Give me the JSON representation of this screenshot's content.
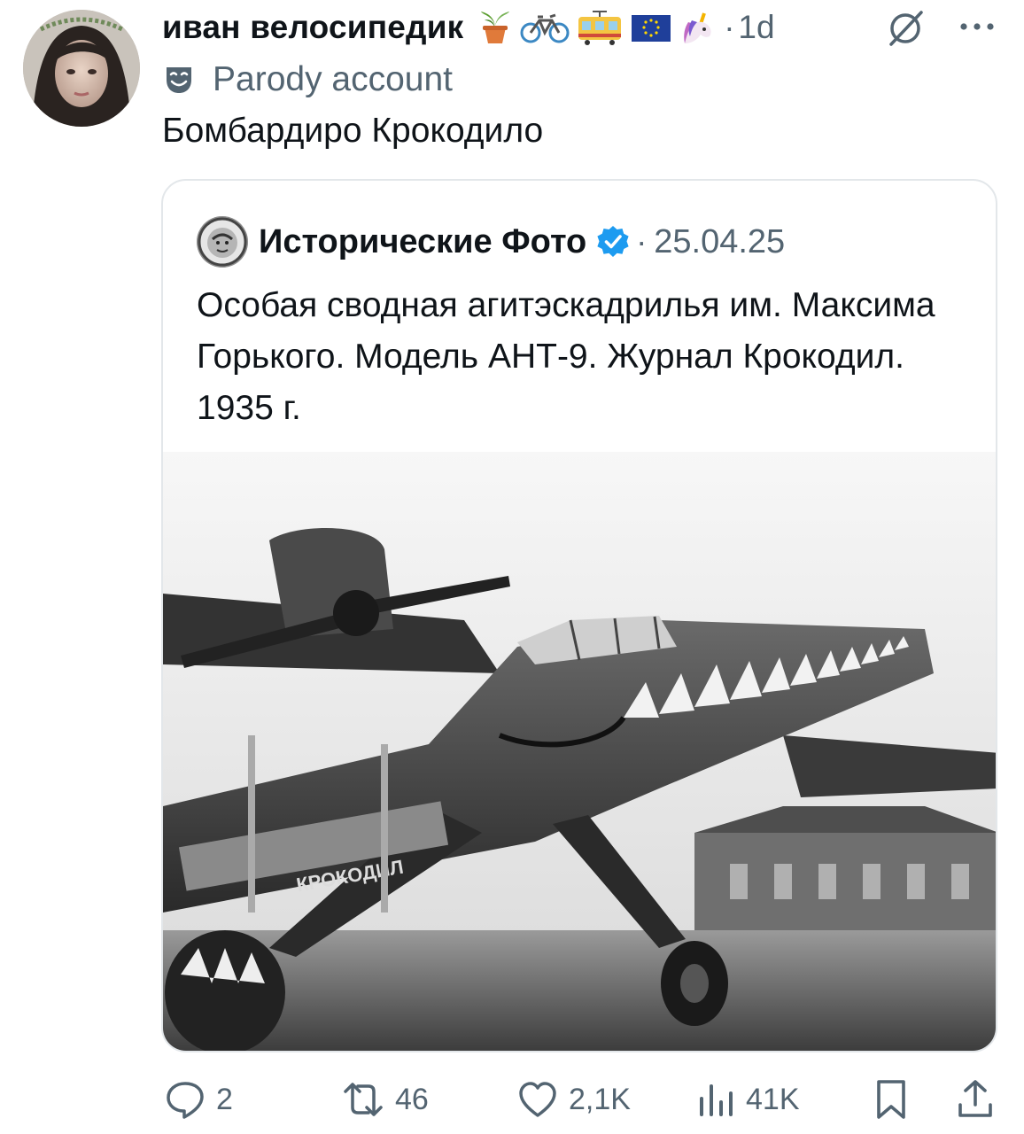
{
  "post": {
    "display_name": "иван велосипедик",
    "emoji_icons": [
      "potted-plant",
      "bicycle",
      "tram",
      "eu-flag",
      "unicorn"
    ],
    "time_separator": "·",
    "time": "1d",
    "badge_label": "Parody account",
    "text": "Бомбардиро Крокодило"
  },
  "quote": {
    "display_name": "Исторические Фото",
    "verified": true,
    "verified_color": "#1d9bf0",
    "separator": "·",
    "date": "25.04.25",
    "text": "Особая сводная агитэскадрилья им. Максима Горького. Модель АНТ-9. Журнал Крокодил. 1935 г.",
    "photo_caption_on_plane": "КРОКОДИЛ"
  },
  "actions": {
    "replies": "2",
    "reposts": "46",
    "likes": "2,1K",
    "views": "41K"
  },
  "colors": {
    "text": "#0f1419",
    "secondary": "#536471",
    "border": "#e3e7ea"
  }
}
